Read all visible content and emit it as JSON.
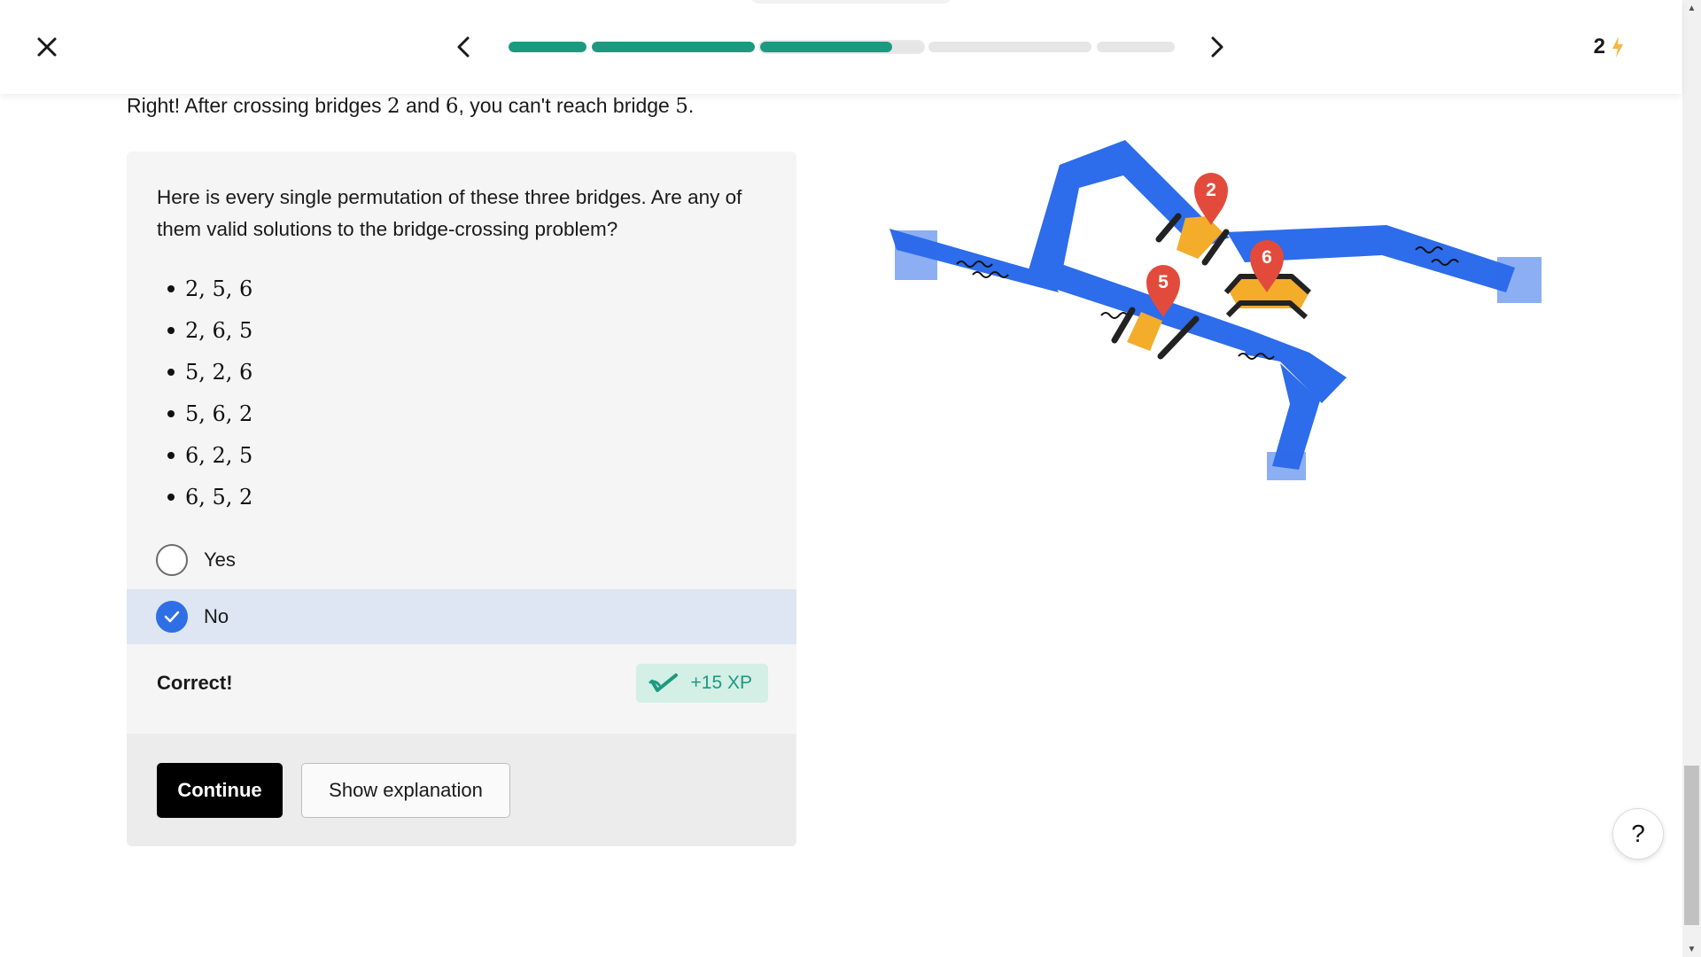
{
  "topbar": {
    "close_icon": "close-icon",
    "prev_icon": "chevron-left-icon",
    "next_icon": "chevron-right-icon",
    "progress": {
      "segments": [
        1,
        1,
        0.81,
        0,
        0
      ],
      "current_segment": 3
    },
    "streak_count": "2",
    "streak_icon": "lightning-icon",
    "streak_icon_color": "#f5b841"
  },
  "feedback": {
    "prefix": "Right! After crossing bridges ",
    "num_a": "2",
    "mid1": " and ",
    "num_b": "6",
    "mid2": ", you can't reach bridge ",
    "num_c": "5",
    "suffix": "."
  },
  "question": {
    "prompt": "Here is every single permutation of these three bridges. Are any of them valid solutions to the bridge-crossing problem?",
    "permutations": [
      "2, 5, 6",
      "2, 6, 5",
      "5, 2, 6",
      "5, 6, 2",
      "6, 2, 5",
      "6, 5, 2"
    ],
    "options": [
      {
        "label": "Yes",
        "selected": false
      },
      {
        "label": "No",
        "selected": true
      }
    ],
    "result": "Correct!",
    "xp": "+15 XP",
    "xp_icon": "xp-check-icon",
    "continue_label": "Continue",
    "explain_label": "Show explanation"
  },
  "diagram": {
    "markers": [
      "2",
      "5",
      "6"
    ],
    "colors": {
      "river": "#2d6cea",
      "bridge": "#f4ac2b",
      "marker": "#e24b3b"
    }
  },
  "help_label": "?",
  "colors": {
    "accent": "#1c9a80",
    "selected_bg": "#dee6f3",
    "radio_selected": "#2f6fe6"
  }
}
